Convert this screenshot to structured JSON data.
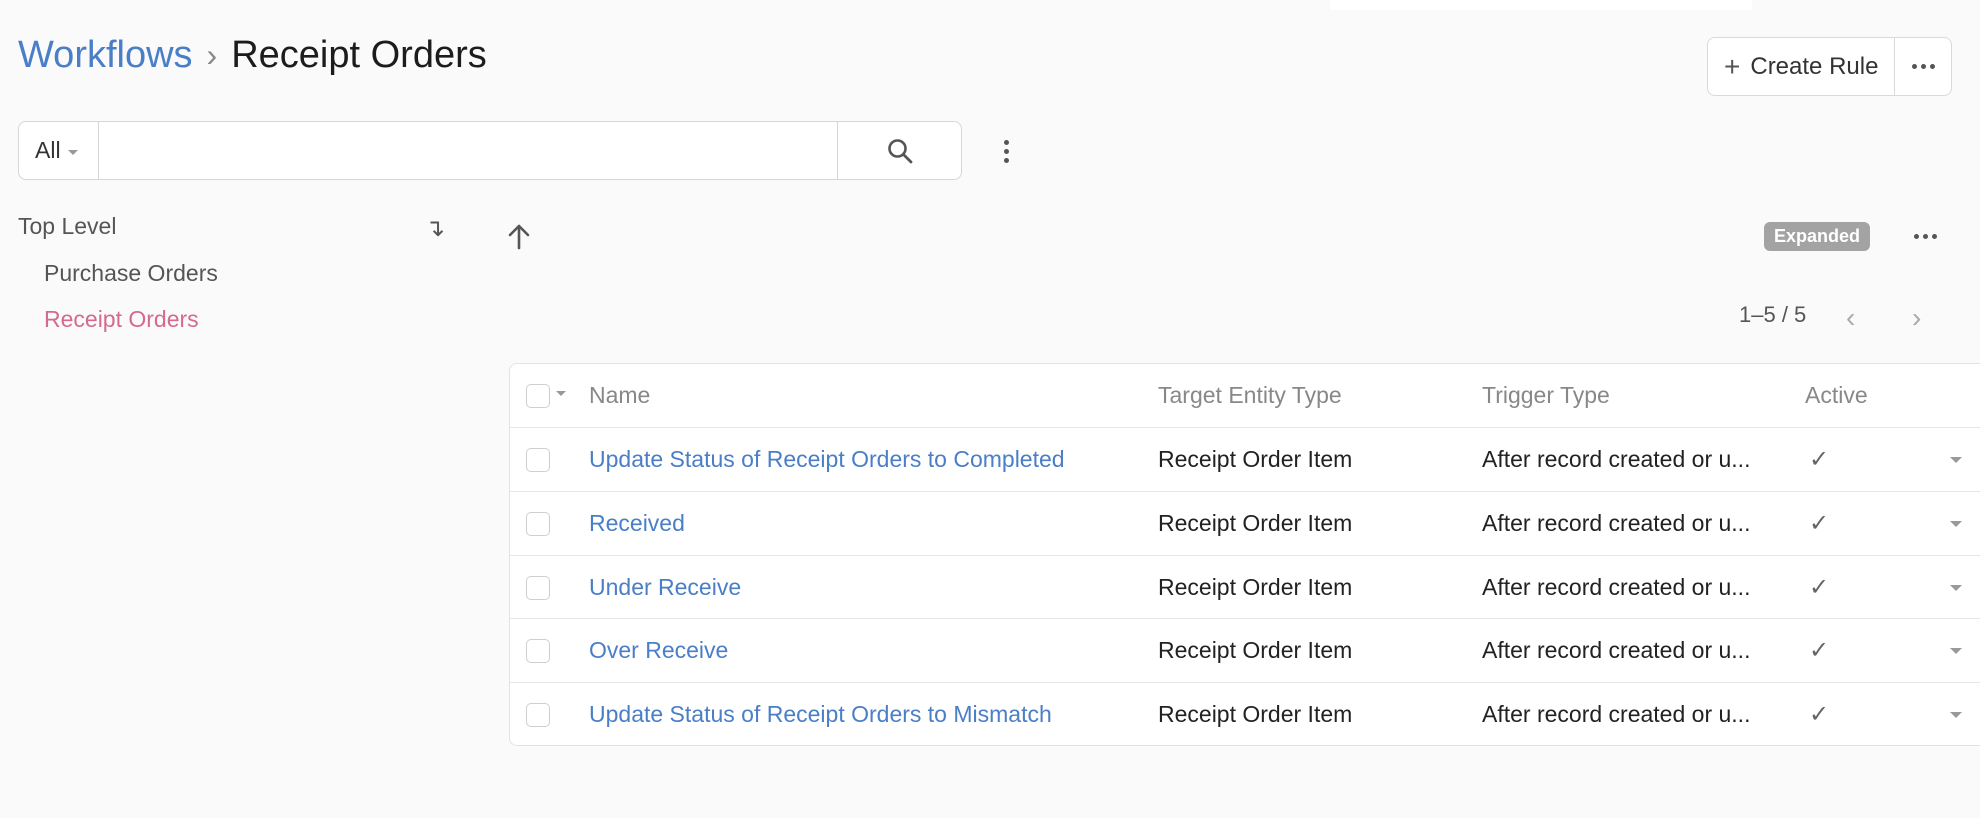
{
  "breadcrumb": {
    "parent": "Workflows",
    "separator": "›",
    "current": "Receipt Orders"
  },
  "toolbar": {
    "create_icon": "+",
    "create_label": "Create Rule",
    "more_icon": "ellipsis-icon"
  },
  "search": {
    "filter_label": "All",
    "placeholder": "",
    "value": "",
    "search_icon": "search-icon"
  },
  "sidebar": {
    "top_label": "Top Level",
    "top_action_icon": "↴",
    "items": [
      {
        "label": "Purchase Orders",
        "active": false
      },
      {
        "label": "Receipt Orders",
        "active": true
      }
    ]
  },
  "list": {
    "view_badge": "Expanded",
    "pagination": "1–5 / 5",
    "prev_icon": "‹",
    "next_icon": "›"
  },
  "table": {
    "columns": [
      "Name",
      "Target Entity Type",
      "Trigger Type",
      "Active"
    ],
    "rows": [
      {
        "name": "Update Status of Receipt Orders to Completed",
        "target": "Receipt Order Item",
        "trigger": "After record created or u...",
        "active": "✓"
      },
      {
        "name": "Received",
        "target": "Receipt Order Item",
        "trigger": "After record created or u...",
        "active": "✓"
      },
      {
        "name": "Under Receive",
        "target": "Receipt Order Item",
        "trigger": "After record created or u...",
        "active": "✓"
      },
      {
        "name": "Over Receive",
        "target": "Receipt Order Item",
        "trigger": "After record created or u...",
        "active": "✓"
      },
      {
        "name": "Update Status of Receipt Orders to Mismatch",
        "target": "Receipt Order Item",
        "trigger": "After record created or u...",
        "active": "✓"
      }
    ]
  },
  "colors": {
    "link": "#4a7ec7",
    "active_tree_item": "#d46b8f",
    "badge_bg": "#a3a3a3"
  }
}
